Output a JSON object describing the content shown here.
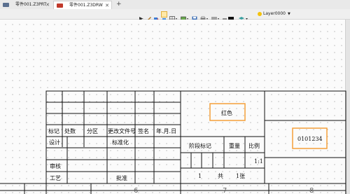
{
  "tabs": [
    {
      "label": "零件001.Z3PRT",
      "close": "✕"
    },
    {
      "label": "零件001.Z3DRW",
      "close": "✕"
    }
  ],
  "tab_add": "+",
  "toolbar": {
    "icons": [
      "pointer-icon",
      "brush-icon",
      "paint-icon",
      "filter-icon",
      "grid-icon",
      "view-icon",
      "save-icon",
      "print-icon",
      "line-color-icon",
      "style-icon"
    ],
    "layer_label": "Layer0000",
    "layer_color": "#f4c20d"
  },
  "title_block": {
    "headers": [
      "标记",
      "处数",
      "分区",
      "更改文件号",
      "签名",
      "年.月.日"
    ],
    "design": "设计",
    "standardize": "标准化",
    "review": "审核",
    "process": "工艺",
    "approve": "批准",
    "stage_mark": "阶段标记",
    "weight": "重量",
    "scale": "比例",
    "scale_value": "1:1",
    "sheet_count": "1",
    "total_label": "共",
    "sheet_label": "1张",
    "material_text": "红色",
    "drawing_number": "0101234",
    "highlight_color": "#f5a03a"
  },
  "border_zones": [
    "6",
    "7",
    "8"
  ]
}
